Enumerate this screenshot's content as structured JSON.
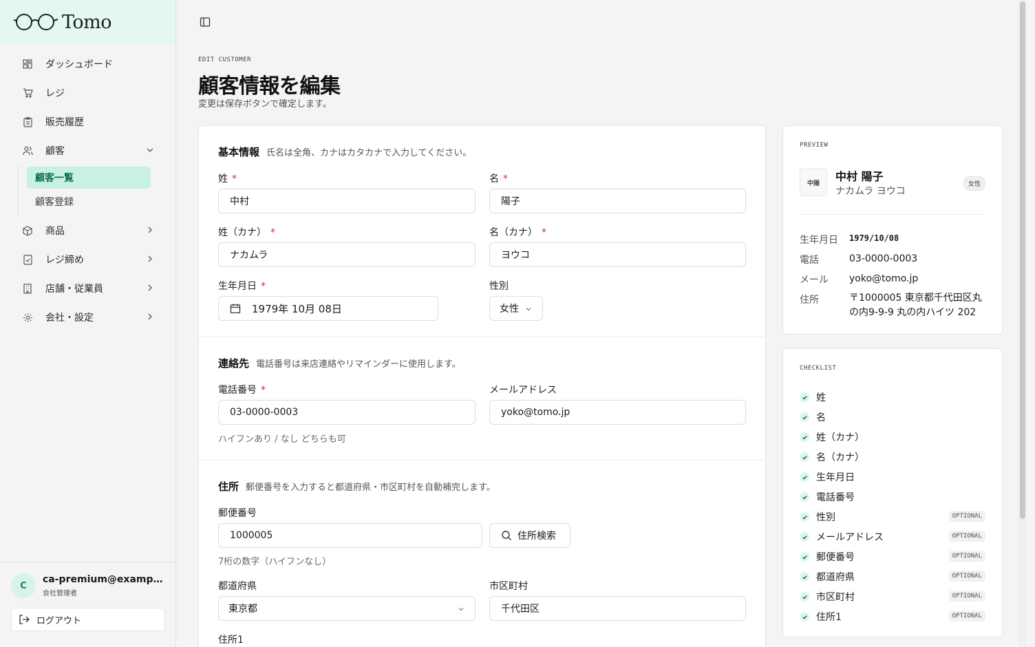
{
  "app": {
    "name": "Tomo"
  },
  "sidebar": {
    "items": [
      {
        "label": "ダッシュボード",
        "icon": "dashboard-icon"
      },
      {
        "label": "レジ",
        "icon": "cart-icon"
      },
      {
        "label": "販売履歴",
        "icon": "clipboard-icon"
      },
      {
        "label": "顧客",
        "icon": "users-icon"
      },
      {
        "label": "商品",
        "icon": "package-icon"
      },
      {
        "label": "レジ締め",
        "icon": "receipt-check-icon"
      },
      {
        "label": "店舗・従業員",
        "icon": "building-icon"
      },
      {
        "label": "会社・設定",
        "icon": "gear-icon"
      }
    ],
    "sub_items": [
      {
        "label": "顧客一覧",
        "active": true
      },
      {
        "label": "顧客登録",
        "active": false
      }
    ],
    "user": {
      "initial": "C",
      "email": "ca-premium@example.com",
      "role": "会社管理者"
    },
    "logout_label": "ログアウト"
  },
  "page": {
    "eyebrow": "EDIT CUSTOMER",
    "title": "顧客情報を編集",
    "subtitle": "変更は保存ボタンで確定します。"
  },
  "form": {
    "basic": {
      "title": "基本情報",
      "desc": "氏名は全角、カナはカタカナで入力してください。",
      "last_name_label": "姓",
      "last_name": "中村",
      "first_name_label": "名",
      "first_name": "陽子",
      "last_kana_label": "姓（カナ）",
      "last_kana": "ナカムラ",
      "first_kana_label": "名（カナ）",
      "first_kana": "ヨウコ",
      "birth_label": "生年月日",
      "birth_value": "1979年 10月 08日",
      "gender_label": "性別",
      "gender_value": "女性"
    },
    "contact": {
      "title": "連絡先",
      "desc": "電話番号は来店連絡やリマインダーに使用します。",
      "phone_label": "電話番号",
      "phone": "03-0000-0003",
      "phone_hint": "ハイフンあり / なし どちらも可",
      "email_label": "メールアドレス",
      "email": "yoko@tomo.jp"
    },
    "address": {
      "title": "住所",
      "desc": "郵便番号を入力すると都道府県・市区町村を自動補完します。",
      "zip_label": "郵便番号",
      "zip": "1000005",
      "zip_search_label": "住所検索",
      "zip_hint": "7桁の数字（ハイフンなし）",
      "pref_label": "都道府県",
      "pref": "東京都",
      "city_label": "市区町村",
      "city": "千代田区",
      "addr1_label": "住所1"
    },
    "required_mark": "*"
  },
  "preview": {
    "heading": "PREVIEW",
    "avatar_text": "中陽",
    "name": "中村 陽子",
    "kana": "ナカムラ ヨウコ",
    "gender_badge": "女性",
    "rows": [
      {
        "key": "生年月日",
        "value": "1979/10/08"
      },
      {
        "key": "電話",
        "value": "03-0000-0003"
      },
      {
        "key": "メール",
        "value": "yoko@tomo.jp"
      },
      {
        "key": "住所",
        "value": "〒1000005 東京都千代田区丸の内9-9-9 丸の内ハイツ 202"
      }
    ]
  },
  "checklist": {
    "heading": "CHECKLIST",
    "optional_label": "OPTIONAL",
    "items": [
      {
        "label": "姓",
        "optional": false
      },
      {
        "label": "名",
        "optional": false
      },
      {
        "label": "姓（カナ）",
        "optional": false
      },
      {
        "label": "名（カナ）",
        "optional": false
      },
      {
        "label": "生年月日",
        "optional": false
      },
      {
        "label": "電話番号",
        "optional": false
      },
      {
        "label": "性別",
        "optional": true
      },
      {
        "label": "メールアドレス",
        "optional": true
      },
      {
        "label": "郵便番号",
        "optional": true
      },
      {
        "label": "都道府県",
        "optional": true
      },
      {
        "label": "市区町村",
        "optional": true
      },
      {
        "label": "住所1",
        "optional": true
      }
    ]
  },
  "colors": {
    "accent": "#16805d",
    "accent_bg": "#c9f1e2",
    "logo_bg": "#e3f8f1",
    "required": "#d12a2a"
  }
}
